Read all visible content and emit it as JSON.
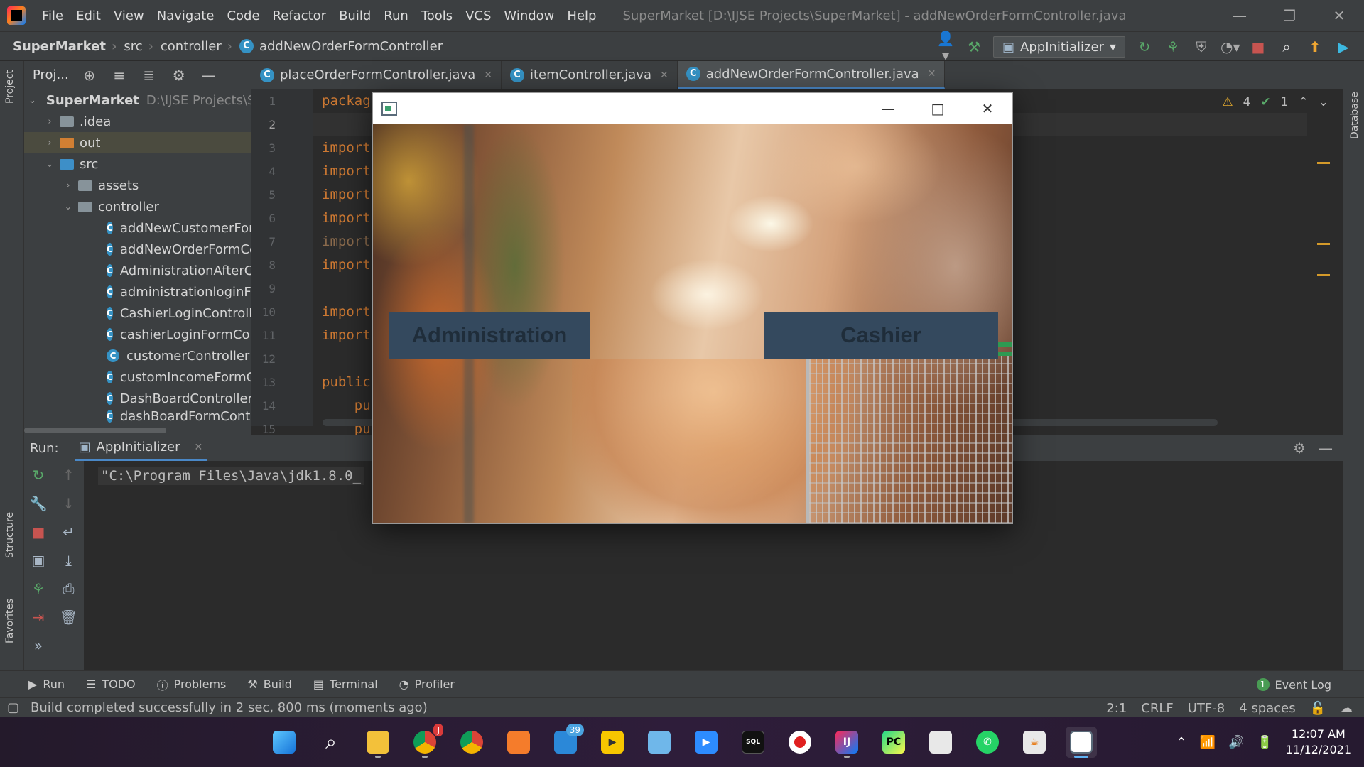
{
  "menu": [
    "File",
    "Edit",
    "View",
    "Navigate",
    "Code",
    "Refactor",
    "Build",
    "Run",
    "Tools",
    "VCS",
    "Window",
    "Help"
  ],
  "window_title": "SuperMarket [D:\\IJSE Projects\\SuperMarket] - addNewOrderFormController.java",
  "breadcrumb": [
    "SuperMarket",
    "src",
    "controller",
    "addNewOrderFormController"
  ],
  "run_config": "AppInitializer",
  "project_panel": {
    "title": "Proj...",
    "root_name": "SuperMarket",
    "root_path": "D:\\IJSE Projects\\S",
    "folders": [
      ".idea",
      "out",
      "src",
      "assets",
      "controller"
    ],
    "files": [
      "addNewCustomerForm",
      "addNewOrderFormCo",
      "AdministrationAfterCo",
      "administrationloginFo",
      "CashierLoginControlle",
      "cashierLoginFormCont",
      "customerController",
      "customIncomeFormCo",
      "DashBoardController",
      "dashBoardFormContro"
    ]
  },
  "tabs": [
    "placeOrderFormController.java",
    "itemController.java",
    "addNewOrderFormController.java"
  ],
  "editor": {
    "line_numbers": [
      "1",
      "2",
      "3",
      "4",
      "5",
      "6",
      "7",
      "8",
      "9",
      "10",
      "11",
      "12",
      "13",
      "14",
      "15"
    ],
    "lines": [
      "packag",
      "",
      "import",
      "import",
      "import",
      "import",
      "import",
      "import",
      "",
      "import",
      "import",
      "",
      "public",
      "    pu",
      "    pu"
    ],
    "warnings": "4",
    "checks": "1"
  },
  "run_panel": {
    "label": "Run:",
    "tab": "AppInitializer",
    "console": "\"C:\\Program Files\\Java\\jdk1.8.0_"
  },
  "side_labels": {
    "project": "Project",
    "structure": "Structure",
    "favorites": "Favorites",
    "database": "Database"
  },
  "tool_windows": [
    "Run",
    "TODO",
    "Problems",
    "Build",
    "Terminal",
    "Profiler"
  ],
  "event_log": {
    "count": "1",
    "label": "Event Log"
  },
  "status": {
    "message": "Build completed successfully in 2 sec, 800 ms (moments ago)",
    "position": "2:1",
    "line_sep": "CRLF",
    "encoding": "UTF-8",
    "indent": "4 spaces"
  },
  "fx_app": {
    "admin_button": "Administration",
    "cashier_button": "Cashier"
  },
  "taskbar": {
    "mail_badge": "39",
    "chrome_badge": "J",
    "time": "12:07 AM",
    "date": "11/12/2021"
  }
}
